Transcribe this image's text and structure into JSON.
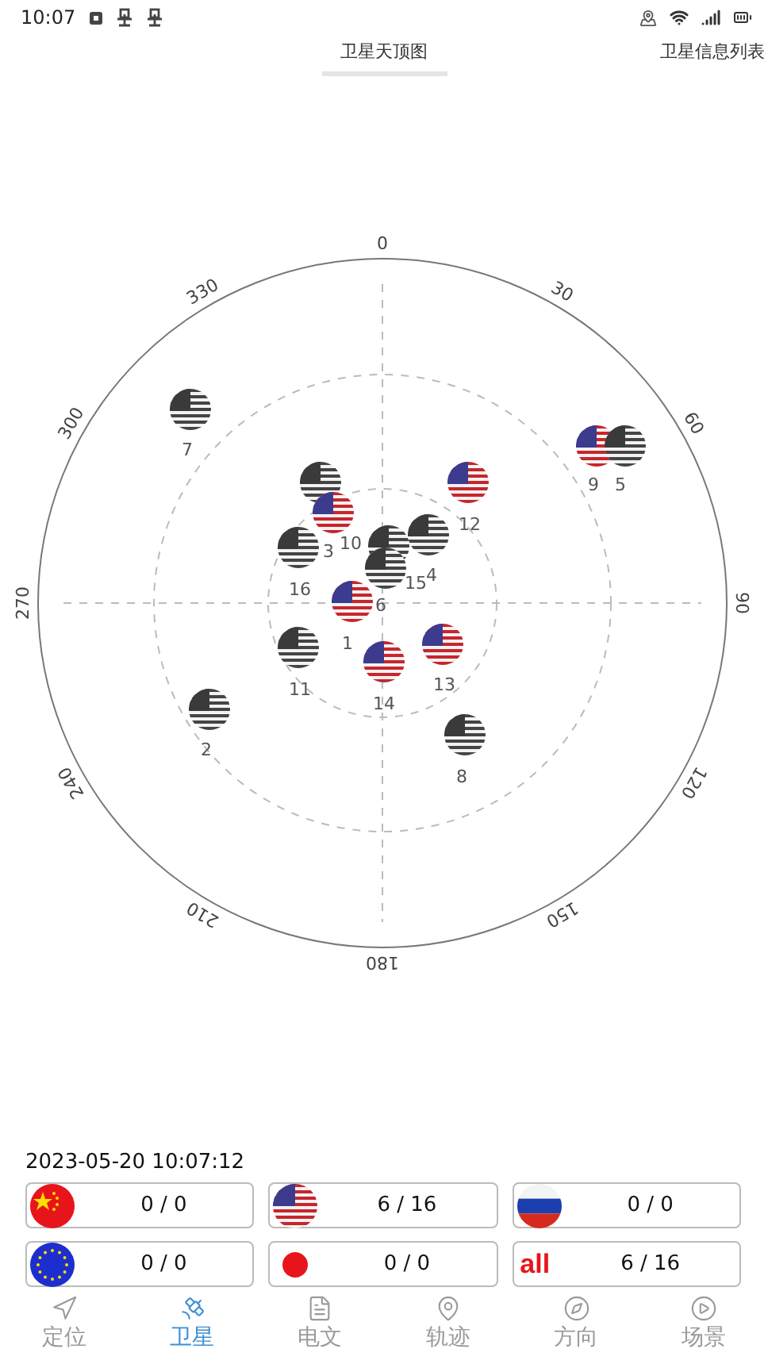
{
  "status_bar": {
    "time": "10:07"
  },
  "tabs": [
    {
      "label": "卫星天顶图",
      "selected": true
    },
    {
      "label": "卫星信息列表",
      "selected": false
    }
  ],
  "sky_plot": {
    "azimuth_labels": [
      "0",
      "30",
      "60",
      "90",
      "120",
      "150",
      "180",
      "210",
      "240",
      "270",
      "300",
      "330"
    ],
    "satellites": [
      {
        "number": "7",
        "used": false
      },
      {
        "number": "3",
        "used": false
      },
      {
        "number": "10",
        "used": true
      },
      {
        "number": "16",
        "used": false
      },
      {
        "number": "12",
        "used": true
      },
      {
        "number": "4",
        "used": false
      },
      {
        "number": "15",
        "used": false
      },
      {
        "number": "6",
        "used": false
      },
      {
        "number": "1",
        "used": true
      },
      {
        "number": "11",
        "used": false
      },
      {
        "number": "14",
        "used": true
      },
      {
        "number": "13",
        "used": true
      },
      {
        "number": "2",
        "used": false
      },
      {
        "number": "8",
        "used": false
      },
      {
        "number": "9",
        "used": true
      },
      {
        "number": "5",
        "used": false
      }
    ]
  },
  "timestamp": "2023-05-20  10:07:12",
  "systems": [
    {
      "kind": "china",
      "count": "0 / 0"
    },
    {
      "kind": "usa",
      "count": "6 / 16"
    },
    {
      "kind": "russia",
      "count": "0 / 0"
    },
    {
      "kind": "eu",
      "count": "0 / 0"
    },
    {
      "kind": "japan",
      "count": "0 / 0"
    },
    {
      "kind": "all",
      "badge": "all",
      "count": "6 / 16"
    }
  ],
  "nav": [
    {
      "kind": "locate",
      "label": "定位",
      "selected": false
    },
    {
      "kind": "satellite",
      "label": "卫星",
      "selected": true
    },
    {
      "kind": "message",
      "label": "电文",
      "selected": false
    },
    {
      "kind": "track",
      "label": "轨迹",
      "selected": false
    },
    {
      "kind": "direction",
      "label": "方向",
      "selected": false
    },
    {
      "kind": "scene",
      "label": "场景",
      "selected": false
    }
  ]
}
